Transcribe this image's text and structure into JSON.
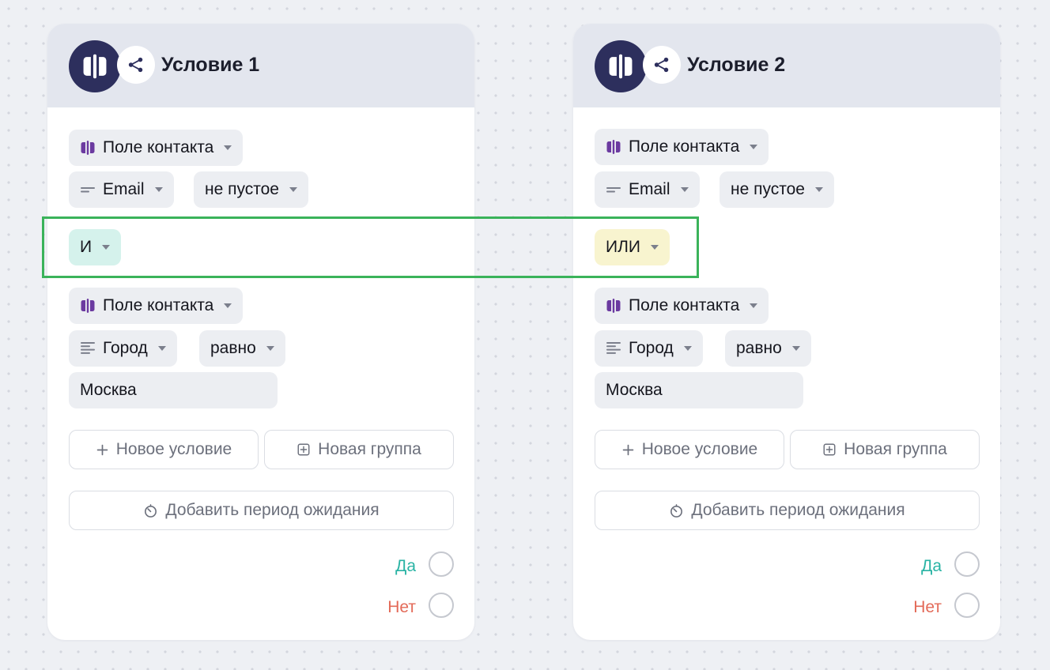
{
  "colors": {
    "node_icon": "#2d2f5d",
    "field_icon": "#6b3aa0",
    "and_chip": "#d5f2ec",
    "or_chip": "#f8f4cf",
    "yes": "#29b3a4",
    "no": "#e36a58",
    "highlight": "#3ab35a"
  },
  "cards": [
    {
      "title": "Условие 1",
      "icon": "field-logo-icon",
      "branch_icon": "share-branch-icon",
      "conditions": [
        {
          "source": "Поле контакта",
          "field": "Email",
          "field_icon": "short-text-icon",
          "operator": "не пустое"
        },
        {
          "source": "Поле контакта",
          "field": "Город",
          "field_icon": "long-text-icon",
          "operator": "равно",
          "value": "Москва"
        }
      ],
      "logic": "И",
      "buttons": {
        "new_condition": "Новое условие",
        "new_group": "Новая группа",
        "add_wait": "Добавить период ожидания"
      },
      "outputs": {
        "yes": "Да",
        "no": "Нет"
      }
    },
    {
      "title": "Условие 2",
      "icon": "field-logo-icon",
      "branch_icon": "share-branch-icon",
      "conditions": [
        {
          "source": "Поле контакта",
          "field": "Email",
          "field_icon": "short-text-icon",
          "operator": "не пустое"
        },
        {
          "source": "Поле контакта",
          "field": "Город",
          "field_icon": "long-text-icon",
          "operator": "равно",
          "value": "Москва"
        }
      ],
      "logic": "ИЛИ",
      "buttons": {
        "new_condition": "Новое условие",
        "new_group": "Новая группа",
        "add_wait": "Добавить период ожидания"
      },
      "outputs": {
        "yes": "Да",
        "no": "Нет"
      }
    }
  ]
}
